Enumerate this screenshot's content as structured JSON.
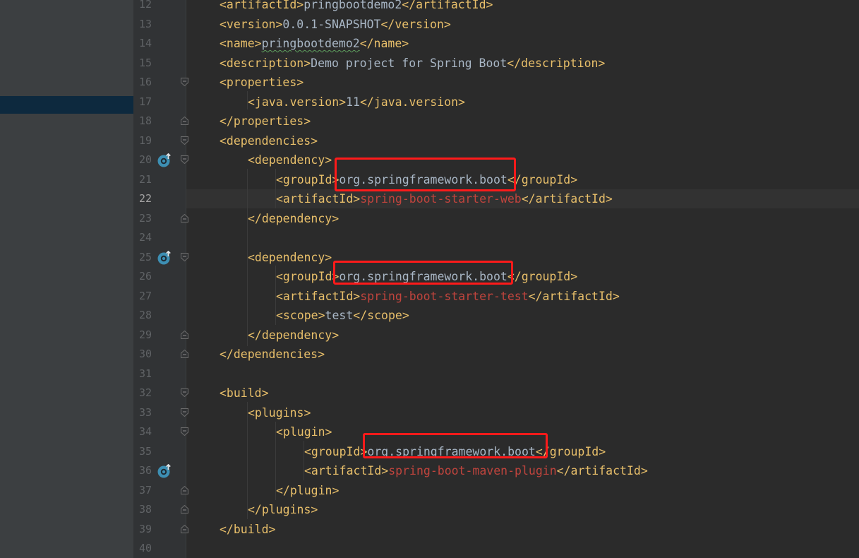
{
  "lines": [
    {
      "num": "12",
      "parts": [
        {
          "t": "<artifactId>",
          "c": "tag"
        },
        {
          "t": "pringbootdemo2",
          "c": "txt"
        },
        {
          "t": "</artifactId>",
          "c": "tag"
        }
      ]
    },
    {
      "num": "13",
      "parts": [
        {
          "t": "<version>",
          "c": "tag"
        },
        {
          "t": "0.0.1-SNAPSHOT",
          "c": "txt"
        },
        {
          "t": "</version>",
          "c": "tag"
        }
      ]
    },
    {
      "num": "14",
      "parts": [
        {
          "t": "<name>",
          "c": "tag"
        },
        {
          "t": "pringbootdemo2",
          "c": "txt wavy"
        },
        {
          "t": "</name>",
          "c": "tag"
        }
      ]
    },
    {
      "num": "15",
      "parts": [
        {
          "t": "<description>",
          "c": "tag"
        },
        {
          "t": "Demo project for Spring Boot",
          "c": "txt"
        },
        {
          "t": "</description>",
          "c": "tag"
        }
      ]
    },
    {
      "num": "16",
      "fold": "open",
      "parts": [
        {
          "t": "<properties>",
          "c": "tag"
        }
      ]
    },
    {
      "num": "17",
      "parts": [
        {
          "t": "<java.version>",
          "c": "tag"
        },
        {
          "t": "11",
          "c": "txt"
        },
        {
          "t": "</java.version>",
          "c": "tag"
        }
      ]
    },
    {
      "num": "18",
      "fold": "close",
      "parts": [
        {
          "t": "</properties>",
          "c": "tag"
        }
      ]
    },
    {
      "num": "19",
      "fold": "open",
      "parts": [
        {
          "t": "<dependencies>",
          "c": "tag"
        }
      ]
    },
    {
      "num": "20",
      "fold": "open",
      "icon": true,
      "parts": [
        {
          "t": "<dependency>",
          "c": "tag"
        }
      ]
    },
    {
      "num": "21",
      "parts": [
        {
          "t": "<groupId>",
          "c": "tag"
        },
        {
          "t": "org.springframework.boot",
          "c": "txt"
        },
        {
          "t": "</groupId>",
          "c": "tag"
        }
      ]
    },
    {
      "num": "22",
      "current": true,
      "parts": [
        {
          "t": "<artifactId>",
          "c": "tag"
        },
        {
          "t": "spring-boot-starter-web",
          "c": "red"
        },
        {
          "t": "</artifactId>",
          "c": "tag"
        }
      ]
    },
    {
      "num": "23",
      "fold": "close",
      "parts": [
        {
          "t": "</dependency>",
          "c": "tag"
        }
      ]
    },
    {
      "num": "24",
      "parts": []
    },
    {
      "num": "25",
      "fold": "open",
      "icon": true,
      "parts": [
        {
          "t": "<dependency>",
          "c": "tag"
        }
      ]
    },
    {
      "num": "26",
      "parts": [
        {
          "t": "<groupId>",
          "c": "tag"
        },
        {
          "t": "org.springframework.boot",
          "c": "txt"
        },
        {
          "t": "</groupId>",
          "c": "tag"
        }
      ]
    },
    {
      "num": "27",
      "parts": [
        {
          "t": "<artifactId>",
          "c": "tag"
        },
        {
          "t": "spring-boot-starter-test",
          "c": "red"
        },
        {
          "t": "</artifactId>",
          "c": "tag"
        }
      ]
    },
    {
      "num": "28",
      "parts": [
        {
          "t": "<scope>",
          "c": "tag"
        },
        {
          "t": "test",
          "c": "txt"
        },
        {
          "t": "</scope>",
          "c": "tag"
        }
      ]
    },
    {
      "num": "29",
      "fold": "close",
      "parts": [
        {
          "t": "</dependency>",
          "c": "tag"
        }
      ]
    },
    {
      "num": "30",
      "fold": "close",
      "parts": [
        {
          "t": "</dependencies>",
          "c": "tag"
        }
      ]
    },
    {
      "num": "31",
      "parts": []
    },
    {
      "num": "32",
      "fold": "open",
      "parts": [
        {
          "t": "<build>",
          "c": "tag"
        }
      ]
    },
    {
      "num": "33",
      "fold": "open",
      "parts": [
        {
          "t": "<plugins>",
          "c": "tag"
        }
      ]
    },
    {
      "num": "34",
      "fold": "open",
      "parts": [
        {
          "t": "<plugin>",
          "c": "tag"
        }
      ]
    },
    {
      "num": "35",
      "parts": [
        {
          "t": "<groupId>",
          "c": "tag"
        },
        {
          "t": "org.springframework.boot",
          "c": "txt"
        },
        {
          "t": "</groupId>",
          "c": "tag"
        }
      ]
    },
    {
      "num": "36",
      "icon": true,
      "parts": [
        {
          "t": "<artifactId>",
          "c": "tag"
        },
        {
          "t": "spring-boot-maven-plugin",
          "c": "red"
        },
        {
          "t": "</artifactId>",
          "c": "tag"
        }
      ]
    },
    {
      "num": "37",
      "fold": "close",
      "parts": [
        {
          "t": "</plugin>",
          "c": "tag"
        }
      ]
    },
    {
      "num": "38",
      "fold": "close",
      "parts": [
        {
          "t": "</plugins>",
          "c": "tag"
        }
      ]
    },
    {
      "num": "39",
      "fold": "close",
      "parts": [
        {
          "t": "</build>",
          "c": "tag"
        }
      ]
    },
    {
      "num": "40",
      "parts": []
    }
  ],
  "colors": {
    "tag": "#e8bf6a",
    "text": "#a9b7c6",
    "value_red": "#c0443d",
    "highlight_box": "#ff1a1a",
    "gutter_icon": "#3d8fb3"
  },
  "icons": {
    "gutter_icon": "maven-dependency-navigate-icon",
    "fold_open": "fold-open-icon",
    "fold_close": "fold-close-icon"
  }
}
